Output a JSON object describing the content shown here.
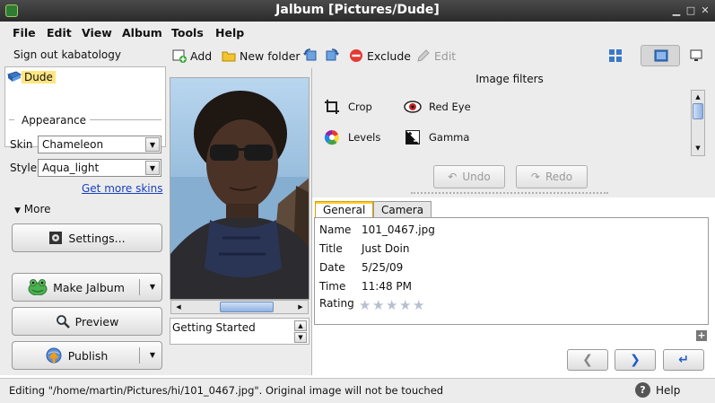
{
  "window": {
    "title": "Jalbum [Pictures/Dude]"
  },
  "menu": [
    "File",
    "Edit",
    "View",
    "Album",
    "Tools",
    "Help"
  ],
  "left": {
    "signout": "Sign out kabatology",
    "tree_item": "Dude",
    "appearance": "Appearance",
    "skin_label": "Skin",
    "skin_value": "Chameleon",
    "style_label": "Style",
    "style_value": "Aqua_light",
    "more_skins": "Get more skins",
    "more": "More",
    "settings": "Settings...",
    "make": "Make Jalbum",
    "preview": "Preview",
    "publish": "Publish"
  },
  "toolbar": {
    "add": "Add",
    "new_folder": "New folder",
    "exclude": "Exclude",
    "edit": "Edit"
  },
  "image_panel": {
    "caption": "Getting Started"
  },
  "filters": {
    "title": "Image filters",
    "crop": "Crop",
    "red_eye": "Red Eye",
    "levels": "Levels",
    "gamma": "Gamma",
    "undo": "Undo",
    "redo": "Redo"
  },
  "tabs": [
    "General",
    "Camera"
  ],
  "info": {
    "name_label": "Name",
    "name_value": "101_0467.jpg",
    "title_label": "Title",
    "title_value": "Just Doin",
    "date_label": "Date",
    "date_value": "5/25/09",
    "time_label": "Time",
    "time_value": "11:48 PM",
    "rating_label": "Rating",
    "rating": 0
  },
  "status": {
    "text": "Editing \"/home/martin/Pictures/hi/101_0467.jpg\". Original image will not be touched",
    "help": "Help"
  },
  "colors": {
    "link": "#1a3fbf",
    "tree_highlight": "#ffe680",
    "nav_arrow": "#1f5cc9"
  }
}
